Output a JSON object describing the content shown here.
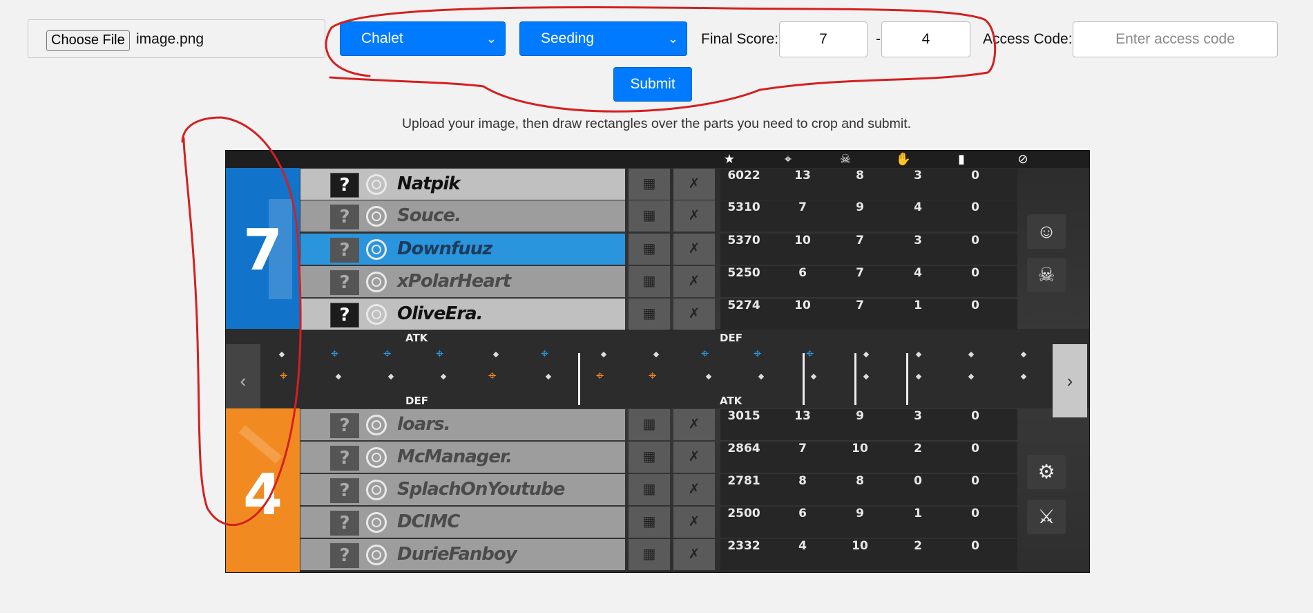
{
  "form": {
    "file_button": "Choose File",
    "file_name": "image.png",
    "map_select": "Chalet",
    "mode_select": "Seeding",
    "final_score_label": "Final Score:",
    "score_team1": "7",
    "score_separator": "-",
    "score_team2": "4",
    "access_code_label": "Access Code:",
    "access_code_placeholder": "Enter access code",
    "submit_label": "Submit"
  },
  "hint": "Upload your image, then draw rectangles over the parts you need to crop and submit.",
  "scoreboard": {
    "team_blue_score": "7",
    "team_orange_score": "4",
    "header_icons": [
      "star-icon",
      "crosshair-icon",
      "skull-icon",
      "handshake-icon",
      "signal-icon",
      "ban-icon"
    ],
    "header_glyphs": [
      "★",
      "⌖",
      "☠",
      "✋",
      "▮",
      "⊘"
    ],
    "timeline": {
      "top_left_label": "ATK",
      "top_right_label": "DEF",
      "bottom_left_label": "DEF",
      "bottom_right_label": "ATK"
    },
    "blue_players": [
      {
        "name": "Natpik",
        "q": "?",
        "score": "6022",
        "kills": "13",
        "deaths": "8",
        "assists": "3",
        "ping": "0"
      },
      {
        "name": "Souce.",
        "q": "?",
        "score": "5310",
        "kills": "7",
        "deaths": "9",
        "assists": "4",
        "ping": "0"
      },
      {
        "name": "Downfuuz",
        "q": "?",
        "score": "5370",
        "kills": "10",
        "deaths": "7",
        "assists": "3",
        "ping": "0"
      },
      {
        "name": "xPolarHeart",
        "q": "?",
        "score": "5250",
        "kills": "6",
        "deaths": "7",
        "assists": "4",
        "ping": "0"
      },
      {
        "name": "OliveEra.",
        "q": "?",
        "score": "5274",
        "kills": "10",
        "deaths": "7",
        "assists": "1",
        "ping": "0"
      }
    ],
    "orange_players": [
      {
        "name": "loars.",
        "q": "?",
        "score": "3015",
        "kills": "13",
        "deaths": "9",
        "assists": "3",
        "ping": "0"
      },
      {
        "name": "McManager.",
        "q": "?",
        "score": "2864",
        "kills": "7",
        "deaths": "10",
        "assists": "2",
        "ping": "0"
      },
      {
        "name": "SplachOnYoutube",
        "q": "?",
        "score": "2781",
        "kills": "8",
        "deaths": "8",
        "assists": "0",
        "ping": "0"
      },
      {
        "name": "DCIMC",
        "q": "?",
        "score": "2500",
        "kills": "6",
        "deaths": "9",
        "assists": "1",
        "ping": "0"
      },
      {
        "name": "DurieFanboy",
        "q": "?",
        "score": "2332",
        "kills": "4",
        "deaths": "10",
        "assists": "2",
        "ping": "0"
      }
    ]
  },
  "colors": {
    "button_blue": "#007bff",
    "team_blue": "#1173c9",
    "team_orange": "#f28a22",
    "annotation_red": "#d42020"
  }
}
